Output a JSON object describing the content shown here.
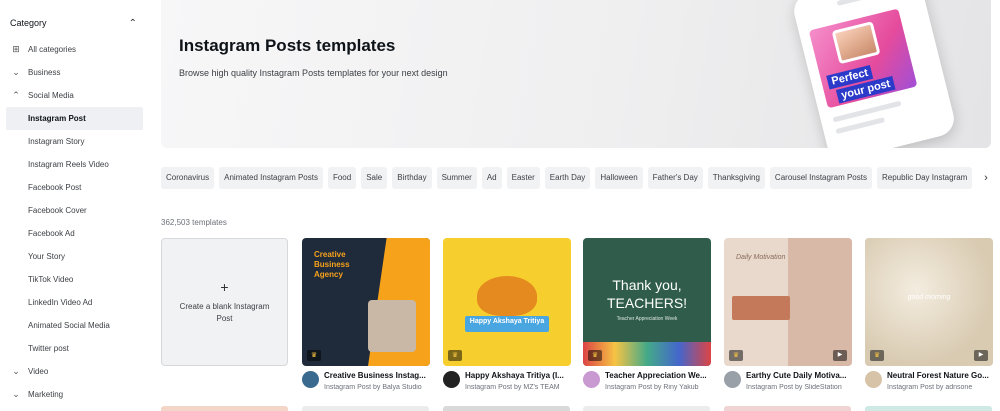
{
  "sidebar": {
    "header": "Category",
    "all_categories": "All categories",
    "business": "Business",
    "social_media": "Social Media",
    "items": [
      "Instagram Post",
      "Instagram Story",
      "Instagram Reels Video",
      "Facebook Post",
      "Facebook Cover",
      "Facebook Ad",
      "Your Story",
      "TikTok Video",
      "LinkedIn Video Ad",
      "Animated Social Media",
      "Twitter post"
    ],
    "video": "Video",
    "marketing": "Marketing"
  },
  "hero": {
    "title": "Instagram Posts templates",
    "subtitle": "Browse high quality Instagram Posts templates for your next design",
    "phone_text_1": "Perfect",
    "phone_text_2": "your post"
  },
  "chips": [
    "Coronavirus",
    "Animated Instagram Posts",
    "Food",
    "Sale",
    "Birthday",
    "Summer",
    "Ad",
    "Easter",
    "Earth Day",
    "Halloween",
    "Father's Day",
    "Thanksgiving",
    "Carousel Instagram Posts",
    "Republic Day Instagram"
  ],
  "count": "362,503 templates",
  "blank_card": {
    "plus": "+",
    "label": "Create a blank Instagram Post"
  },
  "cards": [
    {
      "title": "Creative Business Instag...",
      "sub": "Instagram Post by Balya Studio",
      "art_title": "Creative Business Agency",
      "bg": "#1f2a3a",
      "accent": "#f7a21b"
    },
    {
      "title": "Happy Akshaya Tritiya (I...",
      "sub": "Instagram Post by MZ's TEAM",
      "art_title": "Happy Akshaya Tritiya",
      "bg": "#f6cf2e",
      "accent": "#e58a1f"
    },
    {
      "title": "Teacher Appreciation We...",
      "sub": "Instagram Post by Riny Yakub",
      "art_title": "Thank you, TEACHERS!",
      "art_small": "Teacher Appreciation Week",
      "bg": "#2f5c4b",
      "accent": "#ffffff"
    },
    {
      "title": "Earthy Cute Daily Motiva...",
      "sub": "Instagram Post by SlideStation",
      "art_title": "Daily Motivation",
      "bg": "#e9d9cd",
      "accent": "#c47a5a"
    },
    {
      "title": "Neutral Forest Nature Go...",
      "sub": "Instagram Post by adnsone",
      "art_title": "good morning",
      "bg": "#e6dcc8",
      "accent": "#ffffff"
    }
  ]
}
